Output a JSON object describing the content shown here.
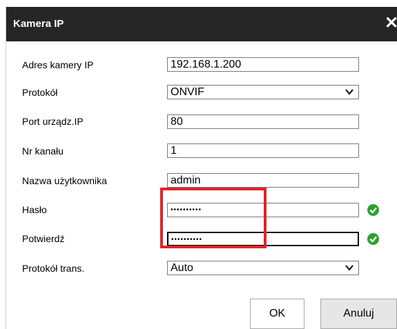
{
  "window": {
    "title": "Kamera IP"
  },
  "form": {
    "ip": {
      "label": "Adres kamery IP",
      "value": "192.168.1.200"
    },
    "protocol": {
      "label": "Protokół",
      "value": "ONVIF"
    },
    "port": {
      "label": "Port urządz.IP",
      "value": "80"
    },
    "channel": {
      "label": "Nr kanału",
      "value": "1"
    },
    "username": {
      "label": "Nazwa użytkownika",
      "value": "admin"
    },
    "password": {
      "label": "Hasło",
      "value": "••••••••••"
    },
    "confirm": {
      "label": "Potwierdź",
      "value": "••••••••••"
    },
    "transport": {
      "label": "Protokół trans.",
      "value": "Auto"
    }
  },
  "buttons": {
    "ok": "OK",
    "cancel": "Anuluj"
  },
  "icons": {
    "close": "close-icon",
    "chevron": "chevron-down-icon",
    "valid": "check-circle-icon"
  },
  "colors": {
    "titlebar": "#262626",
    "highlight": "#e0232a",
    "valid": "#2aa12a"
  }
}
